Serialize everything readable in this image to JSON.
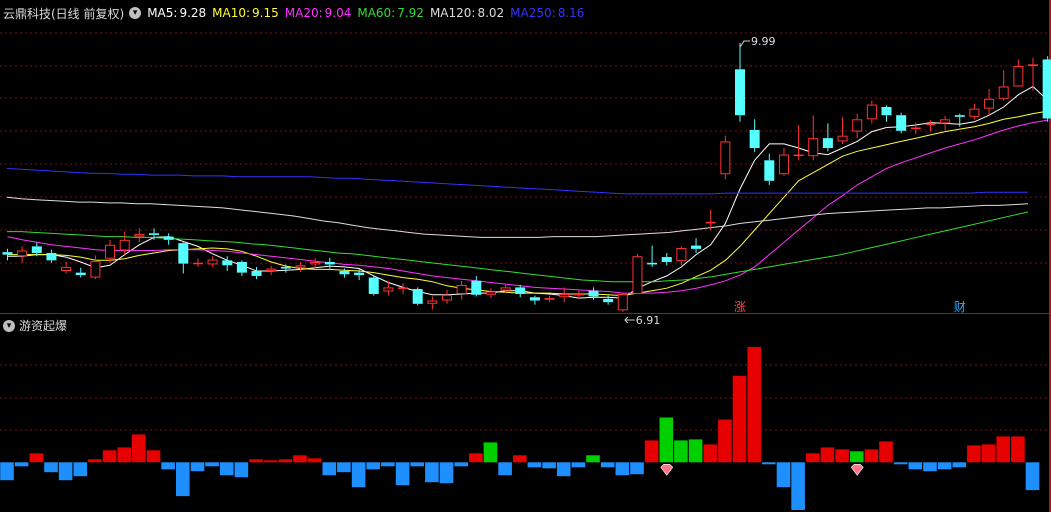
{
  "header": {
    "title": "云鼎科技(日线 前复权)",
    "ma": [
      {
        "label": "MA5:",
        "value": "9.28",
        "color": "#ffffff"
      },
      {
        "label": "MA10:",
        "value": "9.15",
        "color": "#ffff33"
      },
      {
        "label": "MA20:",
        "value": "9.04",
        "color": "#ff33ff"
      },
      {
        "label": "MA60:",
        "value": "7.92",
        "color": "#33dd33"
      },
      {
        "label": "MA120:",
        "value": "8.02",
        "color": "#dddddd"
      },
      {
        "label": "MA250:",
        "value": "8.16",
        "color": "#3333ff"
      }
    ]
  },
  "indicator": {
    "title": "游资起爆"
  },
  "annotations": {
    "high": "9.99",
    "low": "6.91",
    "markers": [
      {
        "text": "涨",
        "color": "#ff4444",
        "index": 50
      },
      {
        "text": "财",
        "color": "#33aaff",
        "index": 65
      }
    ]
  },
  "colors": {
    "up": "#ff3333",
    "down": "#55ffff",
    "grid": "#7a1010",
    "posBar": "#e60000",
    "negBar": "#1e8fff",
    "greenBar": "#00d000",
    "gem": "#ff7788"
  },
  "chart_data": {
    "type": "candlestick",
    "y_range": [
      6.7,
      10.2
    ],
    "candles": [
      [
        7.43,
        7.4,
        7.47,
        7.33
      ],
      [
        7.38,
        7.45,
        7.5,
        7.3
      ],
      [
        7.5,
        7.42,
        7.55,
        7.38
      ],
      [
        7.42,
        7.33,
        7.46,
        7.3
      ],
      [
        7.2,
        7.25,
        7.31,
        7.17
      ],
      [
        7.18,
        7.15,
        7.24,
        7.12
      ],
      [
        7.12,
        7.32,
        7.39,
        7.1
      ],
      [
        7.35,
        7.52,
        7.58,
        7.3
      ],
      [
        7.45,
        7.58,
        7.68,
        7.4
      ],
      [
        7.62,
        7.65,
        7.72,
        7.55
      ],
      [
        7.66,
        7.64,
        7.72,
        7.58
      ],
      [
        7.62,
        7.58,
        7.66,
        7.52
      ],
      [
        7.54,
        7.29,
        7.55,
        7.17
      ],
      [
        7.29,
        7.3,
        7.35,
        7.25
      ],
      [
        7.28,
        7.34,
        7.38,
        7.25
      ],
      [
        7.33,
        7.27,
        7.38,
        7.2
      ],
      [
        7.31,
        7.18,
        7.33,
        7.14
      ],
      [
        7.2,
        7.14,
        7.25,
        7.1
      ],
      [
        7.2,
        7.23,
        7.26,
        7.15
      ],
      [
        7.25,
        7.23,
        7.28,
        7.18
      ],
      [
        7.24,
        7.27,
        7.31,
        7.19
      ],
      [
        7.28,
        7.31,
        7.36,
        7.23
      ],
      [
        7.31,
        7.28,
        7.36,
        7.23
      ],
      [
        7.2,
        7.16,
        7.23,
        7.12
      ],
      [
        7.18,
        7.15,
        7.22,
        7.09
      ],
      [
        7.12,
        6.92,
        7.14,
        6.9
      ],
      [
        6.95,
        7.0,
        7.07,
        6.9
      ],
      [
        7.0,
        7.0,
        7.05,
        6.92
      ],
      [
        6.98,
        6.8,
        7.0,
        6.78
      ],
      [
        6.8,
        6.84,
        6.89,
        6.73
      ],
      [
        6.84,
        6.91,
        6.97,
        6.8
      ],
      [
        6.92,
        7.03,
        7.08,
        6.85
      ],
      [
        7.08,
        6.91,
        7.14,
        6.89
      ],
      [
        6.91,
        6.95,
        6.99,
        6.87
      ],
      [
        6.96,
        7.0,
        7.03,
        6.93
      ],
      [
        7.0,
        6.92,
        7.03,
        6.88
      ],
      [
        6.88,
        6.84,
        6.9,
        6.79
      ],
      [
        6.85,
        6.87,
        6.9,
        6.82
      ],
      [
        6.88,
        6.92,
        7.0,
        6.82
      ],
      [
        6.92,
        6.92,
        6.96,
        6.86
      ],
      [
        6.96,
        6.89,
        7.0,
        6.85
      ],
      [
        6.86,
        6.82,
        6.9,
        6.79
      ],
      [
        6.72,
        6.92,
        6.93,
        6.7
      ],
      [
        6.92,
        7.38,
        7.41,
        6.92
      ],
      [
        7.3,
        7.28,
        7.51,
        7.25
      ],
      [
        7.37,
        7.31,
        7.42,
        7.27
      ],
      [
        7.32,
        7.48,
        7.5,
        7.27
      ],
      [
        7.51,
        7.47,
        7.6,
        7.42
      ],
      [
        7.78,
        7.8,
        7.95,
        7.7
      ],
      [
        8.38,
        8.78,
        8.85,
        8.32
      ],
      [
        9.66,
        9.1,
        9.98,
        9.02
      ],
      [
        8.92,
        8.7,
        9.05,
        8.65
      ],
      [
        8.55,
        8.3,
        8.63,
        8.25
      ],
      [
        8.38,
        8.62,
        8.7,
        8.36
      ],
      [
        8.62,
        8.62,
        8.98,
        8.55
      ],
      [
        8.6,
        8.82,
        9.1,
        8.55
      ],
      [
        8.82,
        8.7,
        9.0,
        8.66
      ],
      [
        8.78,
        8.85,
        9.08,
        8.75
      ],
      [
        8.9,
        9.05,
        9.12,
        8.82
      ],
      [
        9.05,
        9.23,
        9.28,
        9.0
      ],
      [
        9.2,
        9.1,
        9.22,
        9.02
      ],
      [
        9.1,
        8.91,
        9.13,
        8.88
      ],
      [
        8.95,
        8.95,
        9.01,
        8.87
      ],
      [
        8.98,
        9.0,
        9.04,
        8.9
      ],
      [
        9.0,
        9.05,
        9.09,
        8.92
      ],
      [
        9.1,
        9.08,
        9.12,
        8.96
      ],
      [
        9.08,
        9.18,
        9.24,
        9.05
      ],
      [
        9.18,
        9.3,
        9.42,
        9.1
      ],
      [
        9.3,
        9.45,
        9.65,
        9.28
      ],
      [
        9.45,
        9.7,
        9.78,
        9.45
      ],
      [
        9.7,
        9.72,
        9.8,
        9.4
      ],
      [
        9.78,
        9.06,
        9.82,
        9.02
      ]
    ],
    "ma_lines": {
      "MA5": [
        7.38,
        7.38,
        7.4,
        7.4,
        7.37,
        7.31,
        7.24,
        7.27,
        7.4,
        7.52,
        7.61,
        7.62,
        7.56,
        7.5,
        7.41,
        7.33,
        7.27,
        7.2,
        7.2,
        7.21,
        7.22,
        7.24,
        7.26,
        7.25,
        7.23,
        7.14,
        7.06,
        7.0,
        6.95,
        6.91,
        6.91,
        6.92,
        6.93,
        6.93,
        6.96,
        6.96,
        6.93,
        6.92,
        6.9,
        6.87,
        6.88,
        6.88,
        6.87,
        6.99,
        7.07,
        7.14,
        7.25,
        7.4,
        7.52,
        7.78,
        8.2,
        8.55,
        8.75,
        8.75,
        8.7,
        8.64,
        8.62,
        8.7,
        8.78,
        8.9,
        8.95,
        8.96,
        8.98,
        9.01,
        9.0,
        8.99,
        9.02,
        9.1,
        9.2,
        9.35,
        9.45,
        9.28
      ],
      "MA10": [
        7.4,
        7.4,
        7.4,
        7.4,
        7.39,
        7.37,
        7.33,
        7.33,
        7.35,
        7.39,
        7.42,
        7.45,
        7.46,
        7.47,
        7.48,
        7.47,
        7.44,
        7.38,
        7.31,
        7.26,
        7.23,
        7.22,
        7.22,
        7.21,
        7.2,
        7.18,
        7.15,
        7.12,
        7.1,
        7.07,
        7.02,
        6.99,
        6.97,
        6.95,
        6.94,
        6.93,
        6.93,
        6.93,
        6.92,
        6.92,
        6.92,
        6.91,
        6.9,
        6.93,
        6.96,
        6.99,
        7.05,
        7.13,
        7.21,
        7.33,
        7.5,
        7.7,
        7.9,
        8.1,
        8.3,
        8.4,
        8.5,
        8.6,
        8.66,
        8.7,
        8.74,
        8.78,
        8.82,
        8.86,
        8.9,
        8.93,
        8.96,
        9.0,
        9.05,
        9.08,
        9.12,
        9.15
      ],
      "MA20": [
        7.62,
        7.58,
        7.55,
        7.52,
        7.5,
        7.48,
        7.46,
        7.45,
        7.45,
        7.45,
        7.45,
        7.46,
        7.46,
        7.46,
        7.45,
        7.44,
        7.42,
        7.4,
        7.38,
        7.36,
        7.34,
        7.32,
        7.3,
        7.28,
        7.27,
        7.25,
        7.23,
        7.2,
        7.17,
        7.14,
        7.12,
        7.1,
        7.08,
        7.06,
        7.04,
        7.02,
        7.0,
        6.99,
        6.98,
        6.97,
        6.96,
        6.95,
        6.93,
        6.93,
        6.93,
        6.94,
        6.96,
        6.99,
        7.03,
        7.08,
        7.15,
        7.25,
        7.4,
        7.55,
        7.7,
        7.85,
        8.0,
        8.12,
        8.25,
        8.35,
        8.45,
        8.52,
        8.58,
        8.64,
        8.7,
        8.75,
        8.8,
        8.86,
        8.92,
        8.97,
        9.01,
        9.04
      ],
      "MA60": [
        7.68,
        7.68,
        7.67,
        7.66,
        7.65,
        7.64,
        7.63,
        7.62,
        7.62,
        7.61,
        7.61,
        7.6,
        7.59,
        7.58,
        7.57,
        7.56,
        7.55,
        7.53,
        7.52,
        7.5,
        7.48,
        7.46,
        7.44,
        7.42,
        7.41,
        7.39,
        7.37,
        7.35,
        7.33,
        7.31,
        7.29,
        7.27,
        7.25,
        7.23,
        7.21,
        7.19,
        7.17,
        7.15,
        7.13,
        7.11,
        7.09,
        7.08,
        7.07,
        7.07,
        7.07,
        7.07,
        7.08,
        7.09,
        7.11,
        7.13,
        7.16,
        7.19,
        7.22,
        7.25,
        7.28,
        7.31,
        7.34,
        7.37,
        7.4,
        7.44,
        7.48,
        7.52,
        7.56,
        7.6,
        7.64,
        7.68,
        7.72,
        7.76,
        7.8,
        7.84,
        7.88,
        7.92
      ],
      "MA120": [
        8.1,
        8.08,
        8.07,
        8.06,
        8.05,
        8.04,
        8.04,
        8.03,
        8.03,
        8.02,
        8.02,
        8.01,
        8.0,
        7.99,
        7.98,
        7.97,
        7.95,
        7.93,
        7.91,
        7.89,
        7.87,
        7.84,
        7.81,
        7.79,
        7.76,
        7.73,
        7.71,
        7.69,
        7.67,
        7.65,
        7.64,
        7.63,
        7.62,
        7.61,
        7.61,
        7.61,
        7.61,
        7.61,
        7.62,
        7.62,
        7.62,
        7.62,
        7.63,
        7.64,
        7.65,
        7.66,
        7.67,
        7.69,
        7.71,
        7.73,
        7.75,
        7.78,
        7.8,
        7.82,
        7.84,
        7.86,
        7.88,
        7.9,
        7.91,
        7.92,
        7.93,
        7.94,
        7.95,
        7.96,
        7.97,
        7.97,
        7.98,
        7.99,
        8.0,
        8.0,
        8.01,
        8.02
      ],
      "MA250": [
        8.45,
        8.44,
        8.43,
        8.42,
        8.41,
        8.4,
        8.39,
        8.39,
        8.38,
        8.38,
        8.37,
        8.37,
        8.37,
        8.36,
        8.36,
        8.36,
        8.35,
        8.35,
        8.35,
        8.35,
        8.35,
        8.35,
        8.34,
        8.33,
        8.33,
        8.32,
        8.31,
        8.3,
        8.29,
        8.28,
        8.27,
        8.26,
        8.25,
        8.24,
        8.23,
        8.22,
        8.21,
        8.2,
        8.19,
        8.18,
        8.17,
        8.16,
        8.15,
        8.14,
        8.14,
        8.14,
        8.14,
        8.14,
        8.14,
        8.14,
        8.15,
        8.15,
        8.15,
        8.15,
        8.15,
        8.15,
        8.15,
        8.15,
        8.15,
        8.15,
        8.15,
        8.15,
        8.15,
        8.15,
        8.15,
        8.15,
        8.15,
        8.15,
        8.16,
        8.16,
        8.16,
        8.16
      ]
    },
    "indicator": {
      "name": "游资起爆",
      "range": [
        -50,
        130
      ],
      "values": [
        -18,
        -4,
        9,
        -10,
        -18,
        -14,
        3,
        12,
        15,
        28,
        12,
        -7,
        -34,
        -9,
        -4,
        -13,
        -15,
        3,
        2,
        3,
        7,
        4,
        -13,
        -10,
        -25,
        -7,
        -4,
        -23,
        -4,
        -20,
        -21,
        -4,
        9,
        20,
        -13,
        7,
        -5,
        -6,
        -14,
        -5,
        7,
        -5,
        -13,
        -12,
        22,
        45,
        22,
        23,
        18,
        43,
        87,
        116,
        -2,
        -25,
        -48,
        9,
        15,
        13,
        11,
        13,
        21,
        -2,
        -7,
        -9,
        -7,
        -5,
        17,
        18,
        26,
        26,
        -28
      ],
      "green": [
        33,
        40,
        45,
        46,
        47,
        58
      ],
      "gems": [
        45,
        58
      ]
    }
  }
}
